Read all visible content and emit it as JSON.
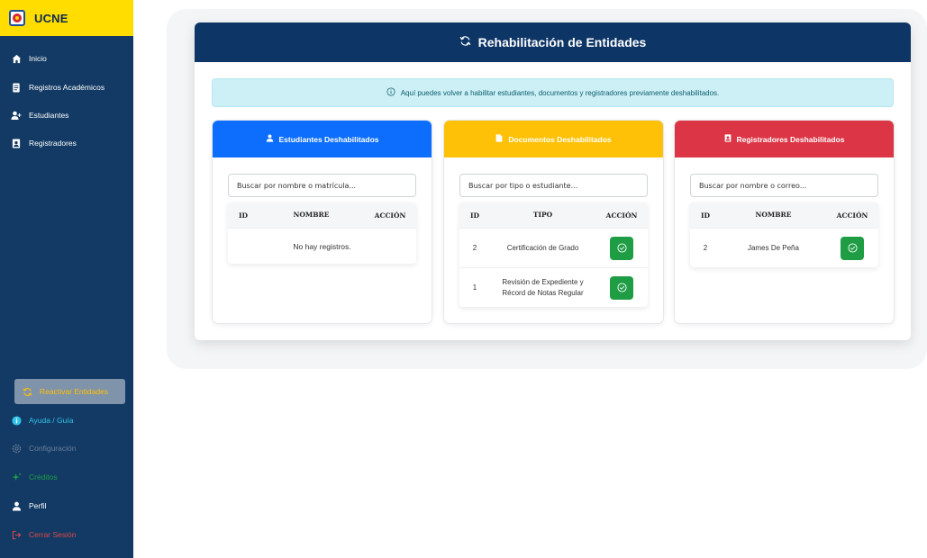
{
  "brand": {
    "name": "UCNE"
  },
  "sidebar": {
    "items": [
      {
        "label": "Inicio",
        "icon": "home-icon",
        "color": "#ffffff"
      },
      {
        "label": "Registros Académicos",
        "icon": "document-icon",
        "color": "#ffffff"
      },
      {
        "label": "Estudiantes",
        "icon": "user-plus-icon",
        "color": "#ffffff"
      },
      {
        "label": "Registradores",
        "icon": "id-card-icon",
        "color": "#ffffff"
      }
    ],
    "bottom_items": [
      {
        "label": "Reactivar Entidades",
        "icon": "refresh-icon",
        "color": "#ffc107"
      },
      {
        "label": "Ayuda / Guía",
        "icon": "info-icon",
        "color": "#33c3e8"
      },
      {
        "label": "Configuración",
        "icon": "gear-icon",
        "color": "#6c7f99"
      },
      {
        "label": "Créditos",
        "icon": "sparkle-icon",
        "color": "#1f9d45"
      },
      {
        "label": "Perfil",
        "icon": "person-icon",
        "color": "#ffffff"
      },
      {
        "label": "Cerrar Sesión",
        "icon": "logout-icon",
        "color": "#e04848"
      }
    ]
  },
  "main": {
    "title": "Rehabilitación de Entidades",
    "alert": "Aquí puedes volver a habilitar estudiantes, documentos y registradores previamente deshabilitados."
  },
  "panels": {
    "estudiantes": {
      "title": "Estudiantes Deshabilitados",
      "color": "#0d6efd",
      "search_placeholder": "Buscar por nombre o matrícula...",
      "columns": [
        "ID",
        "NOMBRE",
        "ACCIÓN"
      ],
      "empty": "No hay registros."
    },
    "documentos": {
      "title": "Documentos Deshabilitados",
      "color": "#ffc107",
      "search_placeholder": "Buscar por tipo o estudiante...",
      "columns": [
        "ID",
        "TIPO",
        "ACCIÓN"
      ],
      "rows": [
        {
          "id": "2",
          "tipo_line1": "Certificación de Grado",
          "tipo_line2": ""
        },
        {
          "id": "1",
          "tipo_line1": "Revisión de Expediente y",
          "tipo_line2": "Récord de Notas Regular"
        }
      ]
    },
    "registradores": {
      "title": "Registradores Deshabilitados",
      "color": "#dc3545",
      "search_placeholder": "Buscar por nombre o correo...",
      "columns": [
        "ID",
        "NOMBRE",
        "ACCIÓN"
      ],
      "rows": [
        {
          "id": "2",
          "nombre": "James De Peña"
        }
      ]
    }
  }
}
